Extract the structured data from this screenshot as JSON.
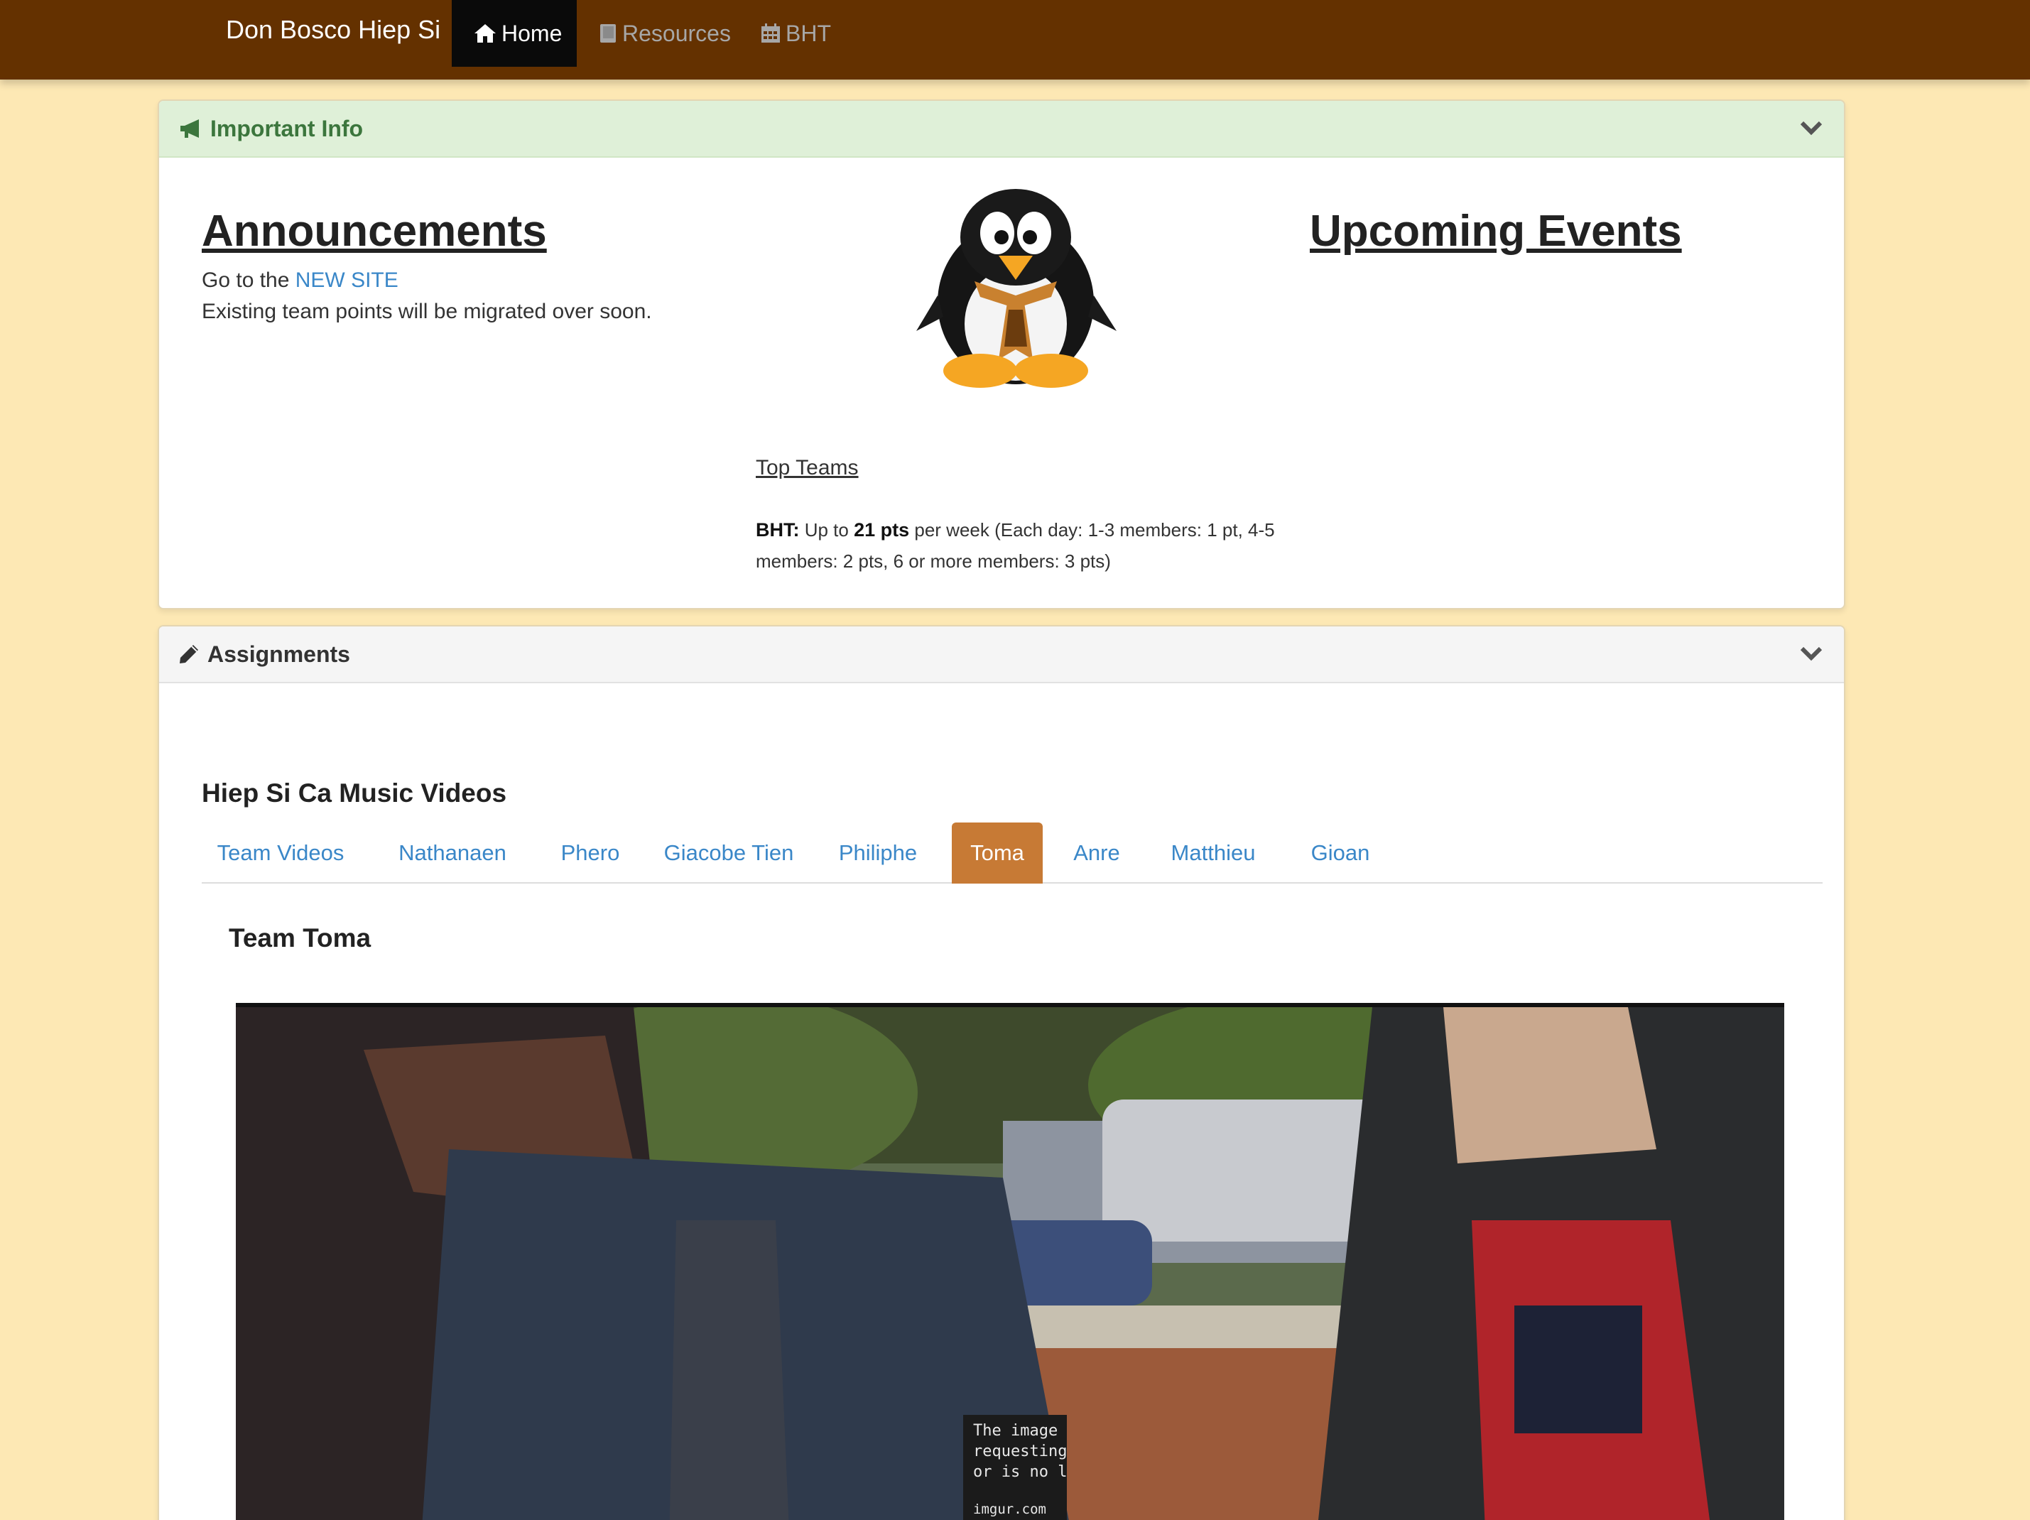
{
  "nav": {
    "brand": "Don Bosco Hiep Si",
    "items": [
      {
        "label": "Home",
        "icon": "home-icon",
        "active": true
      },
      {
        "label": "Resources",
        "icon": "book-icon",
        "active": false
      },
      {
        "label": "BHT",
        "icon": "calendar-icon",
        "active": false
      }
    ]
  },
  "important_info": {
    "title": "Important Info",
    "announcements": {
      "heading": "Announcements",
      "line1_prefix": "Go to the ",
      "line1_link": "NEW SITE",
      "line2": "Existing team points will be migrated over soon."
    },
    "upcoming_events": {
      "heading": "Upcoming Events"
    },
    "top_teams": "Top Teams",
    "bht_note": {
      "label": "BHT:",
      "prefix": " Up to ",
      "points": "21 pts",
      "rest": " per week (Each day: 1-3 members: 1 pt, 4-5 members: 2 pts, 6 or more members: 3 pts)"
    }
  },
  "assignments": {
    "title": "Assignments",
    "section_title": "Hiep Si Ca Music Videos",
    "tabs": [
      "Team Videos",
      "Nathanaen",
      "Phero",
      "Giacobe Tien",
      "Philiphe",
      "Toma",
      "Anre",
      "Matthieu",
      "Gioan"
    ],
    "active_tab": "Toma",
    "team_title": "Team Toma",
    "video_placeholder": {
      "lines": [
        "The image",
        "requesting",
        "or is no lon"
      ],
      "site": "imgur.com"
    }
  },
  "colors": {
    "navbar": "#643100",
    "page_bg": "#fde8b4",
    "active_tab": "#c77a35",
    "link": "#3a87c8",
    "info_header": "#dff0d8"
  }
}
